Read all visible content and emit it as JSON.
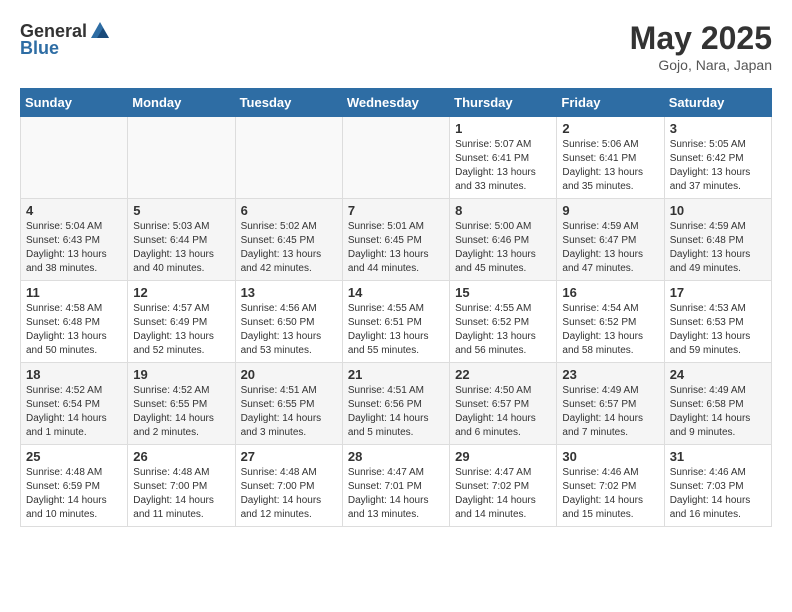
{
  "header": {
    "logo_general": "General",
    "logo_blue": "Blue",
    "month_year": "May 2025",
    "location": "Gojo, Nara, Japan"
  },
  "weekdays": [
    "Sunday",
    "Monday",
    "Tuesday",
    "Wednesday",
    "Thursday",
    "Friday",
    "Saturday"
  ],
  "weeks": [
    [
      {
        "day": "",
        "info": ""
      },
      {
        "day": "",
        "info": ""
      },
      {
        "day": "",
        "info": ""
      },
      {
        "day": "",
        "info": ""
      },
      {
        "day": "1",
        "info": "Sunrise: 5:07 AM\nSunset: 6:41 PM\nDaylight: 13 hours\nand 33 minutes."
      },
      {
        "day": "2",
        "info": "Sunrise: 5:06 AM\nSunset: 6:41 PM\nDaylight: 13 hours\nand 35 minutes."
      },
      {
        "day": "3",
        "info": "Sunrise: 5:05 AM\nSunset: 6:42 PM\nDaylight: 13 hours\nand 37 minutes."
      }
    ],
    [
      {
        "day": "4",
        "info": "Sunrise: 5:04 AM\nSunset: 6:43 PM\nDaylight: 13 hours\nand 38 minutes."
      },
      {
        "day": "5",
        "info": "Sunrise: 5:03 AM\nSunset: 6:44 PM\nDaylight: 13 hours\nand 40 minutes."
      },
      {
        "day": "6",
        "info": "Sunrise: 5:02 AM\nSunset: 6:45 PM\nDaylight: 13 hours\nand 42 minutes."
      },
      {
        "day": "7",
        "info": "Sunrise: 5:01 AM\nSunset: 6:45 PM\nDaylight: 13 hours\nand 44 minutes."
      },
      {
        "day": "8",
        "info": "Sunrise: 5:00 AM\nSunset: 6:46 PM\nDaylight: 13 hours\nand 45 minutes."
      },
      {
        "day": "9",
        "info": "Sunrise: 4:59 AM\nSunset: 6:47 PM\nDaylight: 13 hours\nand 47 minutes."
      },
      {
        "day": "10",
        "info": "Sunrise: 4:59 AM\nSunset: 6:48 PM\nDaylight: 13 hours\nand 49 minutes."
      }
    ],
    [
      {
        "day": "11",
        "info": "Sunrise: 4:58 AM\nSunset: 6:48 PM\nDaylight: 13 hours\nand 50 minutes."
      },
      {
        "day": "12",
        "info": "Sunrise: 4:57 AM\nSunset: 6:49 PM\nDaylight: 13 hours\nand 52 minutes."
      },
      {
        "day": "13",
        "info": "Sunrise: 4:56 AM\nSunset: 6:50 PM\nDaylight: 13 hours\nand 53 minutes."
      },
      {
        "day": "14",
        "info": "Sunrise: 4:55 AM\nSunset: 6:51 PM\nDaylight: 13 hours\nand 55 minutes."
      },
      {
        "day": "15",
        "info": "Sunrise: 4:55 AM\nSunset: 6:52 PM\nDaylight: 13 hours\nand 56 minutes."
      },
      {
        "day": "16",
        "info": "Sunrise: 4:54 AM\nSunset: 6:52 PM\nDaylight: 13 hours\nand 58 minutes."
      },
      {
        "day": "17",
        "info": "Sunrise: 4:53 AM\nSunset: 6:53 PM\nDaylight: 13 hours\nand 59 minutes."
      }
    ],
    [
      {
        "day": "18",
        "info": "Sunrise: 4:52 AM\nSunset: 6:54 PM\nDaylight: 14 hours\nand 1 minute."
      },
      {
        "day": "19",
        "info": "Sunrise: 4:52 AM\nSunset: 6:55 PM\nDaylight: 14 hours\nand 2 minutes."
      },
      {
        "day": "20",
        "info": "Sunrise: 4:51 AM\nSunset: 6:55 PM\nDaylight: 14 hours\nand 3 minutes."
      },
      {
        "day": "21",
        "info": "Sunrise: 4:51 AM\nSunset: 6:56 PM\nDaylight: 14 hours\nand 5 minutes."
      },
      {
        "day": "22",
        "info": "Sunrise: 4:50 AM\nSunset: 6:57 PM\nDaylight: 14 hours\nand 6 minutes."
      },
      {
        "day": "23",
        "info": "Sunrise: 4:49 AM\nSunset: 6:57 PM\nDaylight: 14 hours\nand 7 minutes."
      },
      {
        "day": "24",
        "info": "Sunrise: 4:49 AM\nSunset: 6:58 PM\nDaylight: 14 hours\nand 9 minutes."
      }
    ],
    [
      {
        "day": "25",
        "info": "Sunrise: 4:48 AM\nSunset: 6:59 PM\nDaylight: 14 hours\nand 10 minutes."
      },
      {
        "day": "26",
        "info": "Sunrise: 4:48 AM\nSunset: 7:00 PM\nDaylight: 14 hours\nand 11 minutes."
      },
      {
        "day": "27",
        "info": "Sunrise: 4:48 AM\nSunset: 7:00 PM\nDaylight: 14 hours\nand 12 minutes."
      },
      {
        "day": "28",
        "info": "Sunrise: 4:47 AM\nSunset: 7:01 PM\nDaylight: 14 hours\nand 13 minutes."
      },
      {
        "day": "29",
        "info": "Sunrise: 4:47 AM\nSunset: 7:02 PM\nDaylight: 14 hours\nand 14 minutes."
      },
      {
        "day": "30",
        "info": "Sunrise: 4:46 AM\nSunset: 7:02 PM\nDaylight: 14 hours\nand 15 minutes."
      },
      {
        "day": "31",
        "info": "Sunrise: 4:46 AM\nSunset: 7:03 PM\nDaylight: 14 hours\nand 16 minutes."
      }
    ]
  ]
}
